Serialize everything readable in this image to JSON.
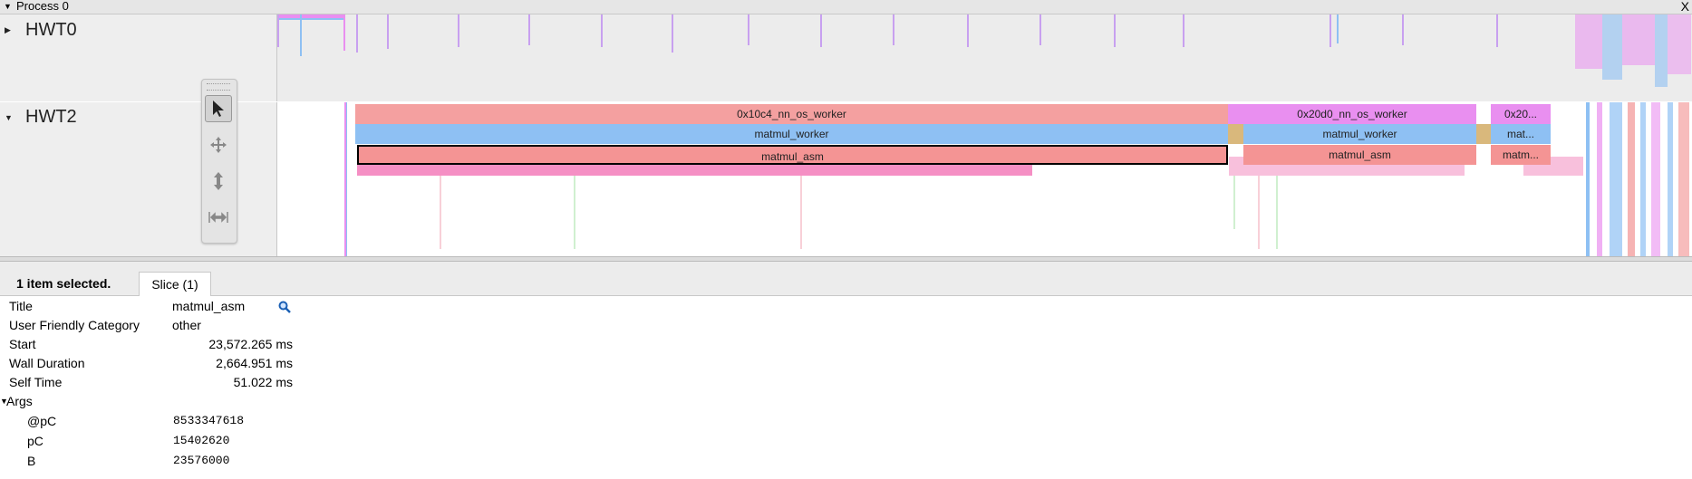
{
  "process": {
    "title": "Process 0",
    "close_label": "X"
  },
  "tracks": [
    {
      "name": "HWT0"
    },
    {
      "name": "HWT2"
    }
  ],
  "slices": {
    "row1": [
      {
        "label": "0x10c4_nn_os_worker",
        "color": "#f4a0a0"
      },
      {
        "label": "0x20d0_nn_os_worker",
        "color": "#e98ff0"
      },
      {
        "label": "0x20...",
        "color": "#e98ff0"
      }
    ],
    "row2": [
      {
        "label": "matmul_worker",
        "color": "#8ec0f3"
      },
      {
        "label": "matmul_worker",
        "color": "#8ec0f3"
      },
      {
        "label": "mat...",
        "color": "#8ec0f3"
      }
    ],
    "row3": [
      {
        "label": "matmul_asm",
        "color": "#f49494"
      },
      {
        "label": "matmul_asm",
        "color": "#f49494"
      },
      {
        "label": "matm...",
        "color": "#f49494"
      }
    ]
  },
  "toolbar": {
    "tools": [
      "selection",
      "pan",
      "zoom",
      "timing"
    ]
  },
  "selection": {
    "count_label": "1 item selected.",
    "tab_label": "Slice (1)"
  },
  "details": {
    "fields": [
      {
        "key": "Title",
        "value": "matmul_asm"
      },
      {
        "key": "User Friendly Category",
        "value": "other"
      },
      {
        "key": "Start",
        "value": "23,572.265 ms"
      },
      {
        "key": "Wall Duration",
        "value": "2,664.951 ms"
      },
      {
        "key": "Self Time",
        "value": "51.022 ms"
      }
    ],
    "args_label": "Args",
    "args": [
      {
        "key": "@pC",
        "value": "8533347618"
      },
      {
        "key": "pC",
        "value": "15402620"
      },
      {
        "key": "B",
        "value": "23576000"
      }
    ]
  }
}
